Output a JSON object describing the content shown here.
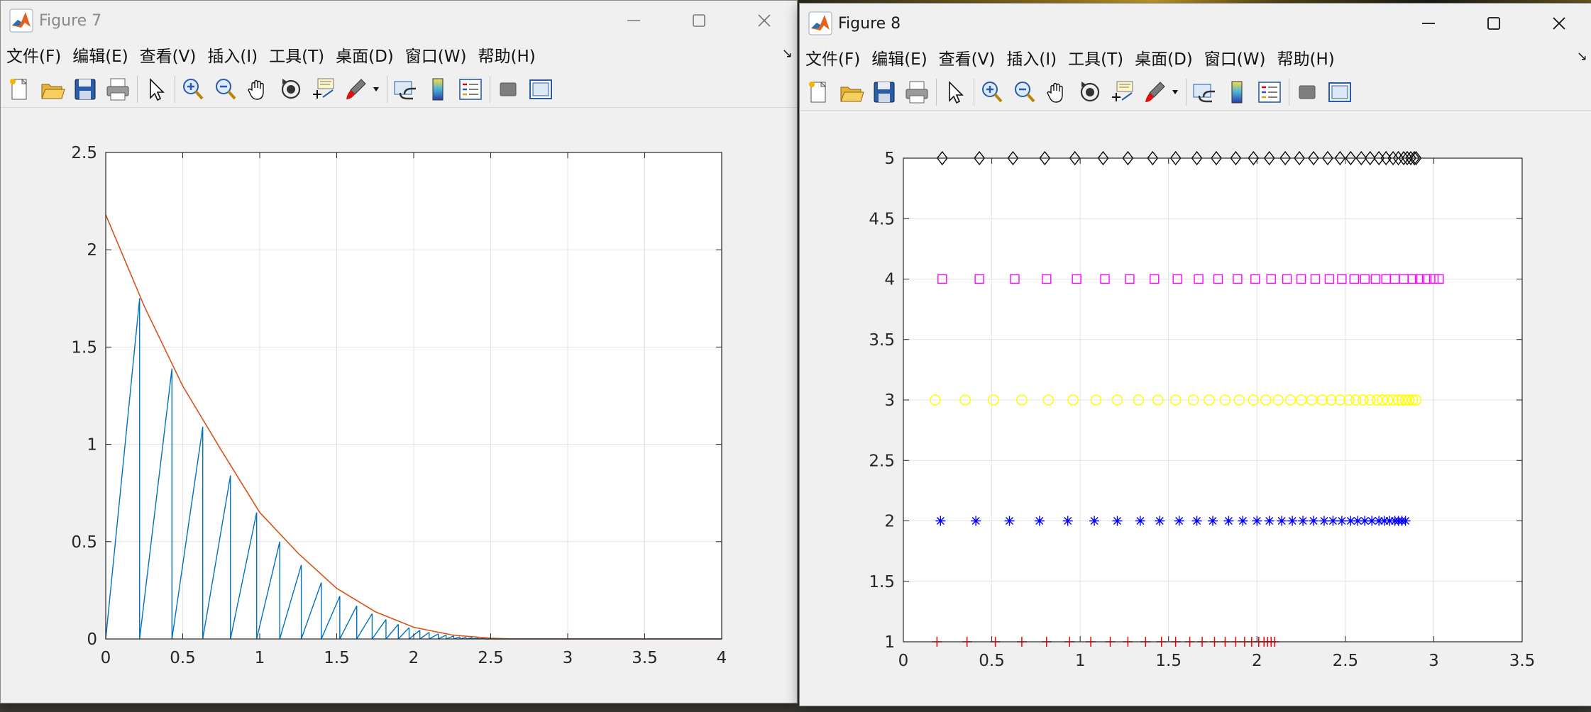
{
  "windows": [
    {
      "id": "fig7",
      "title": "Figure 7",
      "menu": [
        "文件(F)",
        "编辑(E)",
        "查看(V)",
        "插入(I)",
        "工具(T)",
        "桌面(D)",
        "窗口(W)",
        "帮助(H)"
      ]
    },
    {
      "id": "fig8",
      "title": "Figure 8",
      "menu": [
        "文件(F)",
        "编辑(E)",
        "查看(V)",
        "插入(I)",
        "工具(T)",
        "桌面(D)",
        "窗口(W)",
        "帮助(H)"
      ]
    }
  ],
  "toolbar_icons": [
    "new-figure-icon",
    "open-file-icon",
    "save-icon",
    "print-icon",
    "pointer-icon",
    "zoom-in-icon",
    "zoom-out-icon",
    "pan-hand-icon",
    "rotate-3d-icon",
    "data-cursor-icon",
    "brush-icon",
    "brush-dropdown-icon",
    "link-plot-icon",
    "colorbar-icon",
    "legend-icon",
    "hide-plot-tools-icon",
    "show-plot-tools-icon"
  ],
  "colors": {
    "matlab_blue": "#0072BD",
    "matlab_orange": "#D95319",
    "red": "#FF0000",
    "blue": "#0000FF",
    "yellow": "#FFFF00",
    "magenta": "#FF00FF",
    "black": "#000000"
  },
  "chart_data": [
    {
      "type": "line",
      "figure": "Figure 7",
      "xlim": [
        0,
        4
      ],
      "ylim": [
        0,
        2.5
      ],
      "xticks": [
        "0",
        "0.5",
        "1",
        "1.5",
        "2",
        "2.5",
        "3",
        "3.5",
        "4"
      ],
      "yticks": [
        "0",
        "0.5",
        "1",
        "1.5",
        "2",
        "2.5"
      ],
      "grid": true,
      "series": [
        {
          "style": "envelope-curve",
          "color": "#D95319",
          "x": [
            0,
            0.25,
            0.5,
            0.75,
            1,
            1.25,
            1.5,
            1.75,
            2,
            2.25,
            2.5,
            2.65,
            3,
            3.5,
            4
          ],
          "y": [
            2.18,
            1.71,
            1.3,
            0.97,
            0.65,
            0.44,
            0.26,
            0.14,
            0.06,
            0.02,
            0.004,
            0,
            0,
            0,
            0
          ]
        },
        {
          "style": "sawtooth-teeth",
          "color": "#0072BD",
          "x": [
            0.22,
            0.43,
            0.63,
            0.81,
            0.98,
            1.13,
            1.27,
            1.4,
            1.52,
            1.63,
            1.73,
            1.82,
            1.9,
            1.97,
            2.04,
            2.1,
            2.16,
            2.21,
            2.26,
            2.3,
            2.34,
            2.38,
            2.42,
            2.46
          ],
          "y": [
            1.75,
            1.39,
            1.09,
            0.84,
            0.65,
            0.5,
            0.38,
            0.29,
            0.22,
            0.17,
            0.13,
            0.1,
            0.075,
            0.058,
            0.045,
            0.034,
            0.026,
            0.02,
            0.015,
            0.011,
            0.008,
            0.006,
            0.004,
            0.003
          ]
        }
      ]
    },
    {
      "type": "scatter",
      "figure": "Figure 8",
      "xlim": [
        0,
        3.5
      ],
      "ylim": [
        1,
        5
      ],
      "xticks": [
        "0",
        "0.5",
        "1",
        "1.5",
        "2",
        "2.5",
        "3",
        "3.5"
      ],
      "yticks": [
        "1",
        "1.5",
        "2",
        "2.5",
        "3",
        "3.5",
        "4",
        "4.5",
        "5"
      ],
      "grid": true,
      "series": [
        {
          "marker": "plus",
          "color": "#FF0000",
          "y": 1,
          "x": [
            0.19,
            0.36,
            0.52,
            0.67,
            0.81,
            0.94,
            1.06,
            1.17,
            1.27,
            1.37,
            1.46,
            1.54,
            1.62,
            1.69,
            1.76,
            1.82,
            1.88,
            1.93,
            1.97,
            2.01,
            2.04,
            2.06,
            2.08,
            2.1
          ]
        },
        {
          "marker": "asterisk",
          "color": "#0000FF",
          "y": 2,
          "x": [
            0.21,
            0.41,
            0.6,
            0.77,
            0.93,
            1.08,
            1.21,
            1.34,
            1.45,
            1.56,
            1.66,
            1.75,
            1.84,
            1.92,
            2,
            2.07,
            2.14,
            2.2,
            2.26,
            2.32,
            2.38,
            2.43,
            2.48,
            2.53,
            2.57,
            2.61,
            2.65,
            2.69,
            2.72,
            2.75,
            2.78,
            2.8,
            2.82,
            2.84
          ]
        },
        {
          "marker": "circle",
          "color": "#FFFF00",
          "y": 3,
          "x": [
            0.18,
            0.35,
            0.51,
            0.67,
            0.82,
            0.96,
            1.09,
            1.21,
            1.33,
            1.44,
            1.54,
            1.64,
            1.73,
            1.82,
            1.9,
            1.98,
            2.05,
            2.12,
            2.19,
            2.25,
            2.31,
            2.37,
            2.42,
            2.47,
            2.52,
            2.56,
            2.6,
            2.64,
            2.68,
            2.71,
            2.74,
            2.77,
            2.8,
            2.82,
            2.84,
            2.86,
            2.88,
            2.9
          ]
        },
        {
          "marker": "square",
          "color": "#FF00FF",
          "y": 4,
          "x": [
            0.22,
            0.43,
            0.63,
            0.81,
            0.98,
            1.14,
            1.28,
            1.42,
            1.55,
            1.67,
            1.78,
            1.89,
            1.99,
            2.08,
            2.17,
            2.25,
            2.33,
            2.41,
            2.48,
            2.55,
            2.61,
            2.67,
            2.73,
            2.78,
            2.83,
            2.88,
            2.92,
            2.96,
            3,
            3.03
          ]
        },
        {
          "marker": "diamond",
          "color": "#000000",
          "y": 5,
          "x": [
            0.22,
            0.43,
            0.62,
            0.8,
            0.97,
            1.13,
            1.27,
            1.41,
            1.54,
            1.66,
            1.77,
            1.88,
            1.98,
            2.07,
            2.16,
            2.24,
            2.32,
            2.4,
            2.47,
            2.53,
            2.59,
            2.64,
            2.69,
            2.73,
            2.77,
            2.8,
            2.83,
            2.85,
            2.87,
            2.89,
            2.9
          ]
        }
      ]
    }
  ]
}
